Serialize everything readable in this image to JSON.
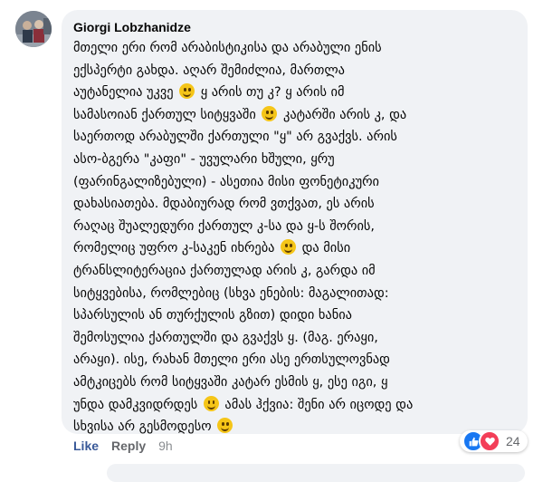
{
  "comment": {
    "author": "Giorgi Lobzhanidze",
    "segments": [
      "მთელი ერი რომ არაბისტიკისა და არაბული ენის\nექსპერტი გახდა. აღარ შემიძლია, მართლა\nაუტანელია უკვე ",
      " ყ არის თუ კ? ყ არის იმ\nსამასოიან ქართულ სიტყვაში ",
      " კატარში არის კ, და\nსაერთოდ არაბულში ქართული \"ყ\" არ გვაქვს. არის\nასო-ბგერა \"კაფი\" - უვულარი ხშული, ყრუ\n(ფარინგალიზებული) - ასეთია მისი ფონეტიკური\nდახასიათება. მდაბიურად რომ ვთქვათ, ეს არის\nრაღაც შუალედური ქართულ კ-სა და ყ-ს შორის,\nრომელიც უფრო კ-საკენ იხრება ",
      " და მისი\nტრანსლიტერაცია ქართულად არის კ, გარდა იმ\nსიტყვებისა, რომლებიც (სხვა ენების: მაგალითად:\nსპარსულის ან თურქულის გზით) დიდი ხანია\nშემოსულია ქართულში და გვაქვს ყ. (მაგ. ერაყი,\nარაყი). ისე, რახან მთელი ერი ასე ერთსულოვნად\nამტკიცებს რომ სიტყვაში კატარ ესმის ყ, ესე იგი, ყ\nუნდა დამკვიდრდეს ",
      " ამას ჰქვია: შენი არ იცოდე და\nსხვისა არ გესმოდესო ",
      ""
    ],
    "emoji_icon": "slightly-smiling-face"
  },
  "actions": {
    "like": "Like",
    "reply": "Reply",
    "time": "9h"
  },
  "reactions": {
    "icons": [
      "like-reaction-icon",
      "love-reaction-icon"
    ],
    "count": "24",
    "colors": {
      "like": "#1877f2",
      "love": "#f33e58"
    }
  },
  "colors": {
    "bubble": "#f0f2f5",
    "like_link": "#385898",
    "secondary_text": "#65676b"
  }
}
